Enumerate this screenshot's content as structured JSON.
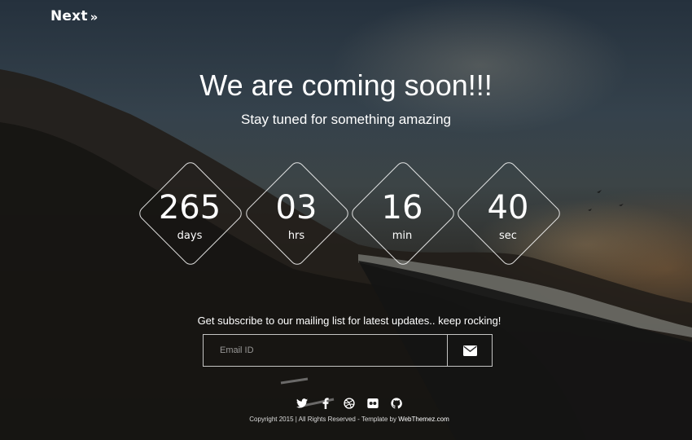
{
  "brand": {
    "name": "Next",
    "chevron": "»"
  },
  "hero": {
    "title": "We are coming soon!!!",
    "subtitle": "Stay tuned for something amazing"
  },
  "countdown": [
    {
      "value": "265",
      "unit": "days"
    },
    {
      "value": "03",
      "unit": "hrs"
    },
    {
      "value": "16",
      "unit": "min"
    },
    {
      "value": "40",
      "unit": "sec"
    }
  ],
  "subscribe": {
    "text": "Get subscribe to our mailing list for latest updates.. keep rocking!",
    "email_placeholder": "Email ID",
    "email_value": "",
    "submit_icon": "envelope-icon"
  },
  "social": [
    "twitter-icon",
    "facebook-icon",
    "dribbble-icon",
    "flickr-icon",
    "github-icon"
  ],
  "footer": {
    "copyright": "Copyright 2015 | All Rights Reserved - Template by ",
    "link": "WebThemez.com"
  },
  "colors": {
    "text": "#ffffff",
    "border": "#ffffff",
    "background": "#151617"
  }
}
